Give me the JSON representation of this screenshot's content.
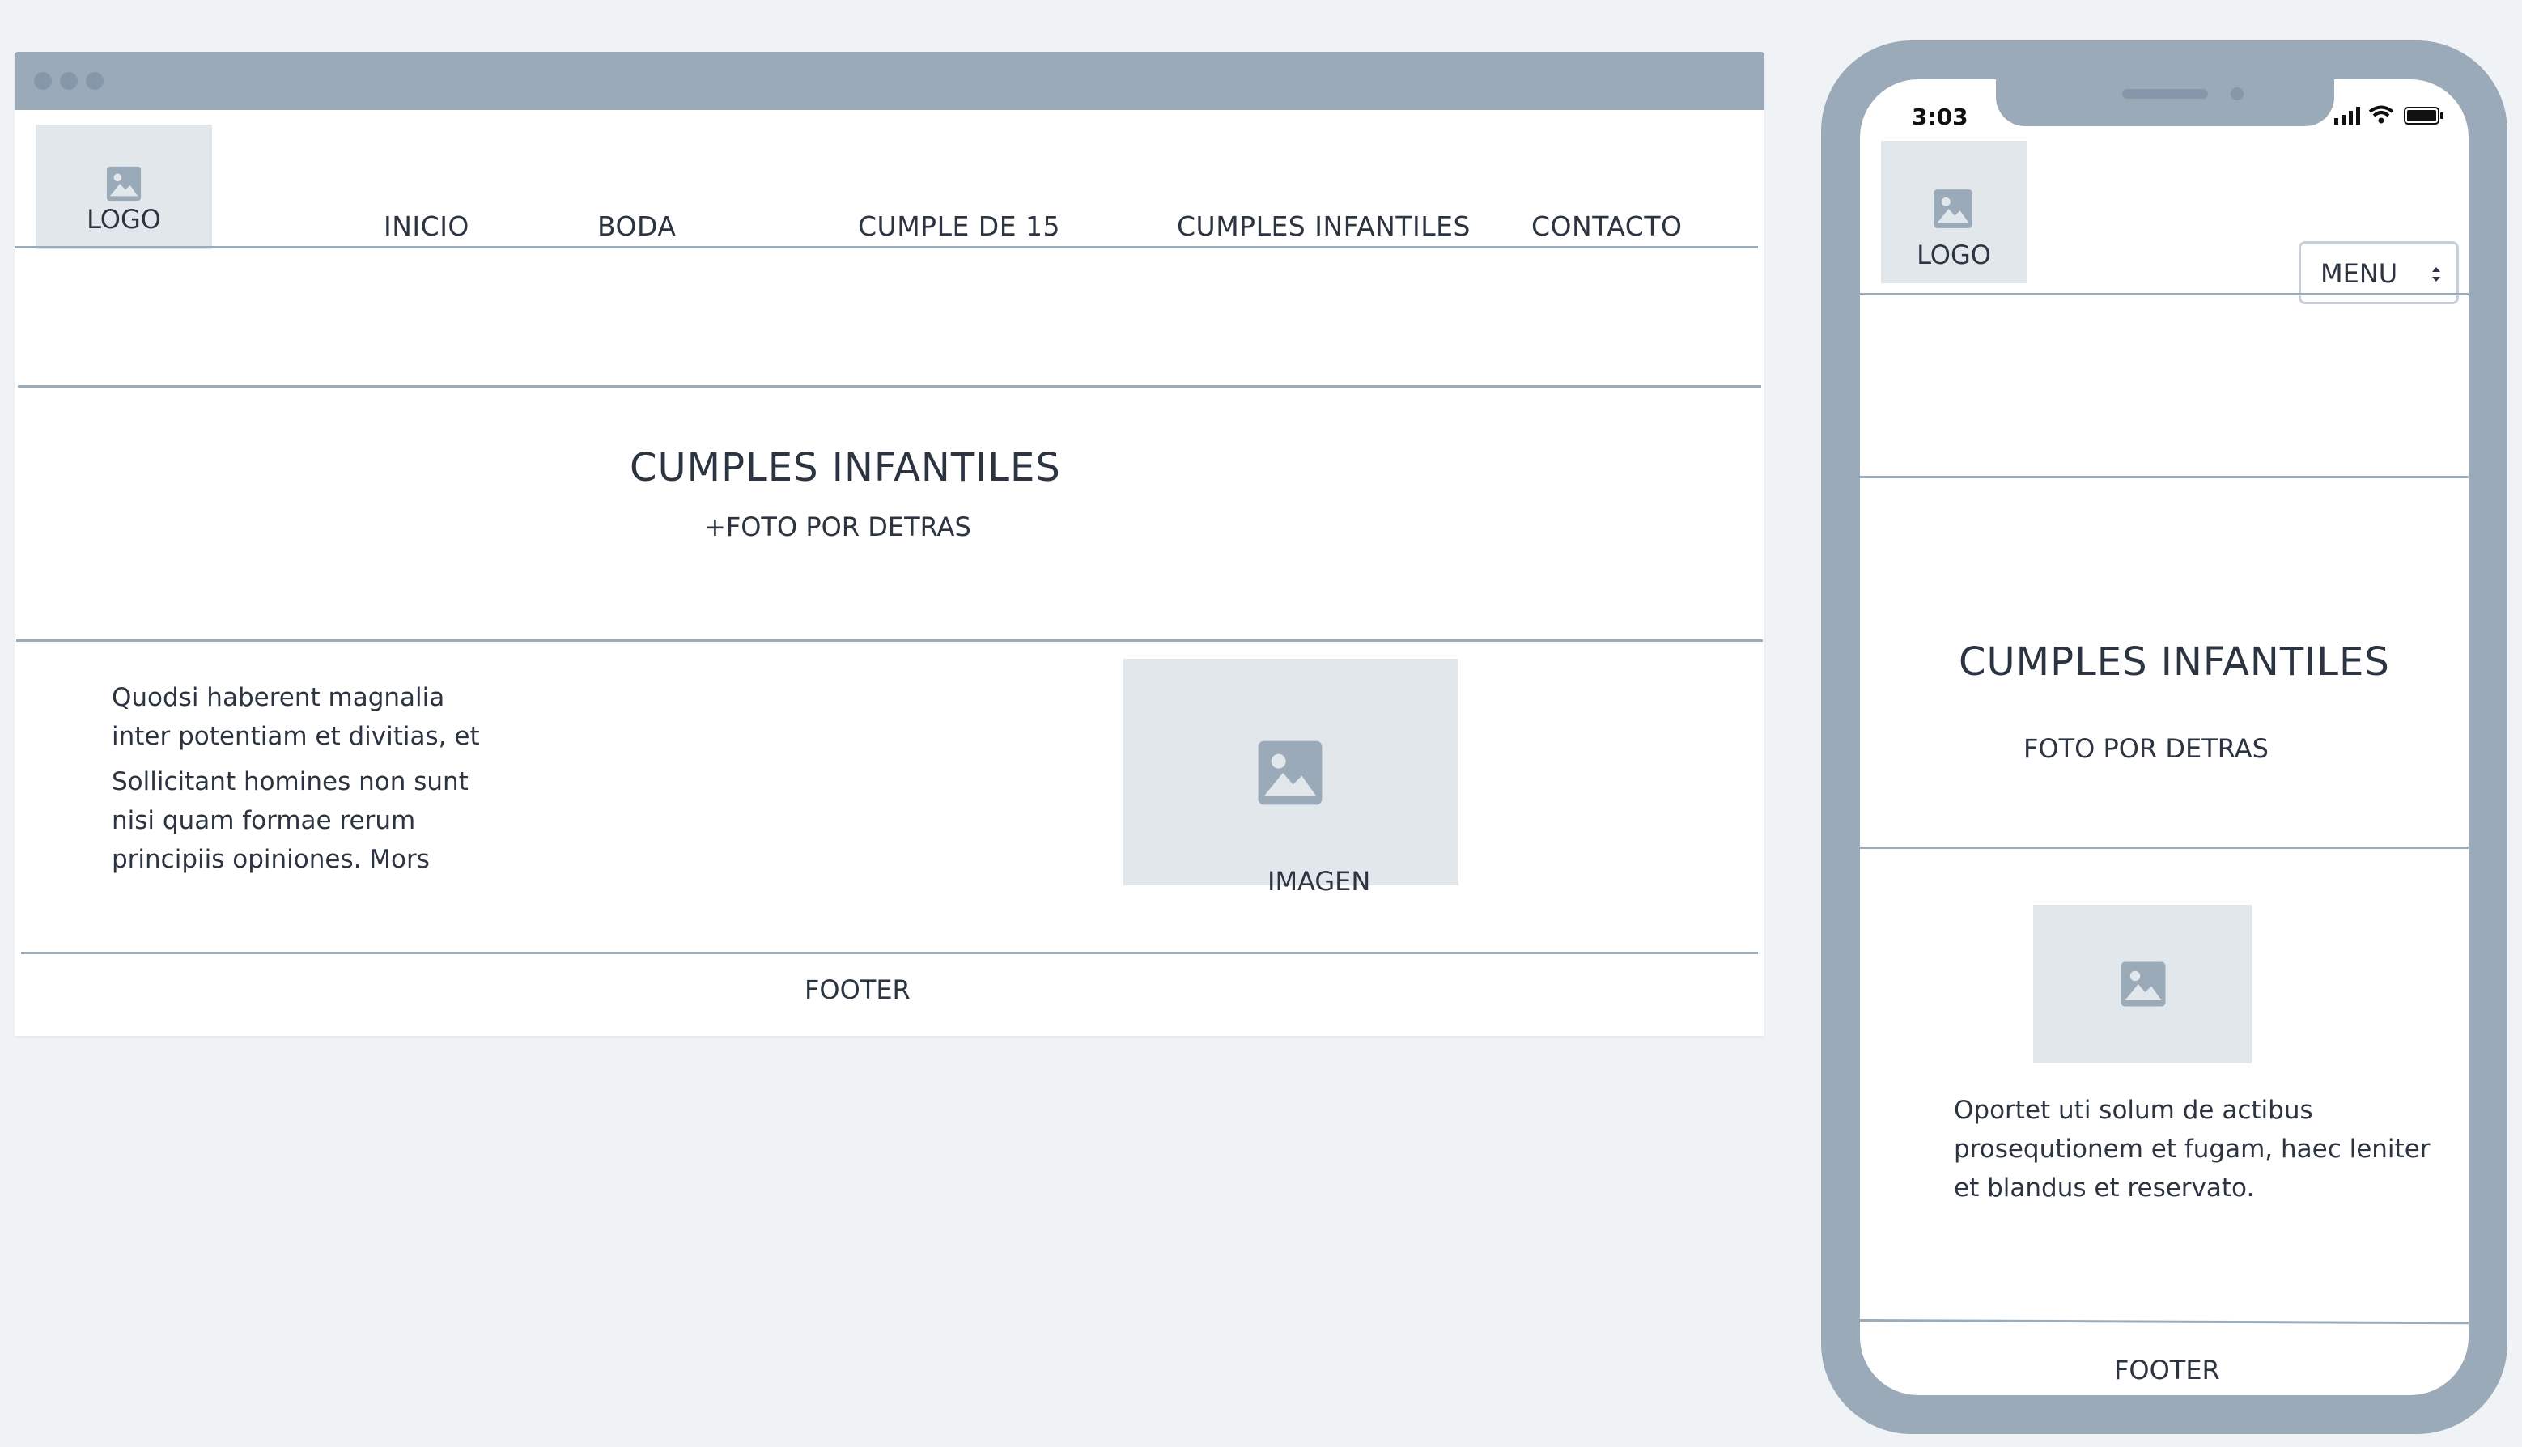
{
  "desktop": {
    "logo_label": "LOGO",
    "nav": [
      {
        "label": "INICIO"
      },
      {
        "label": "BODA"
      },
      {
        "label": "CUMPLE DE 15"
      },
      {
        "label": "CUMPLES INFANTILES"
      },
      {
        "label": "CONTACTO"
      }
    ],
    "hero_title": "CUMPLES INFANTILES",
    "hero_subtitle": "+FOTO POR DETRAS",
    "body_lines": [
      "Quodsi haberent magnalia",
      "inter potentiam et divitias, et",
      "Sollicitant homines non sunt",
      "nisi quam formae rerum",
      "principiis opiniones. Mors"
    ],
    "image_label": "IMAGEN",
    "footer": "FOOTER"
  },
  "phone": {
    "time": "3:03",
    "logo_label": "LOGO",
    "menu_label": "MENU",
    "hero_title": "CUMPLES INFANTILES",
    "hero_subtitle": "FOTO POR DETRAS",
    "body_lines": [
      "Oportet uti solum de actibus",
      "prosequtionem et fugam, haec leniter",
      "et blandus et reservato."
    ],
    "footer": "FOOTER"
  },
  "colors": {
    "background": "#f0f3f6",
    "frame": "#9baab8",
    "placeholder": "#e2e7eb",
    "text": "#2b3440"
  },
  "icons": [
    "image-placeholder-icon",
    "signal-icon",
    "wifi-icon",
    "battery-icon",
    "select-arrows-icon"
  ]
}
